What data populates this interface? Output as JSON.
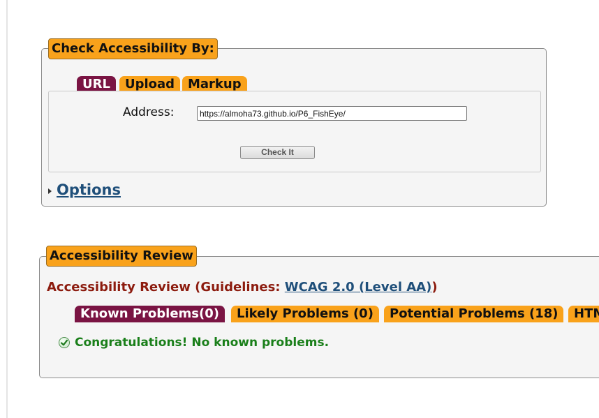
{
  "check_panel": {
    "legend": "Check Accessibility By:",
    "tabs": [
      {
        "label": "URL",
        "active": true
      },
      {
        "label": "Upload",
        "active": false
      },
      {
        "label": "Markup",
        "active": false
      }
    ],
    "address_label": "Address:",
    "address_value": "https://almoha73.github.io/P6_FishEye/",
    "check_button": "Check It",
    "options_link": "Options"
  },
  "review_panel": {
    "legend": "Accessibility Review",
    "heading_prefix": "Accessibility Review (Guidelines: ",
    "guideline_link": "WCAG 2.0 (Level AA)",
    "heading_suffix": ")",
    "tabs": [
      {
        "label": "Known Problems(0)",
        "active": true
      },
      {
        "label": "Likely Problems (0)",
        "active": false
      },
      {
        "label": "Potential Problems (18)",
        "active": false
      },
      {
        "label": "HTML Validation",
        "active": false
      }
    ],
    "message": "Congratulations! No known problems."
  },
  "colors": {
    "tab_orange": "#f9a21b",
    "tab_active": "#7a1443",
    "heading_red": "#8c1b0e",
    "link_blue": "#1f4f7a",
    "success_green": "#1a7f1a"
  },
  "icons": [
    "expand-triangle-icon",
    "checkmark-icon"
  ]
}
